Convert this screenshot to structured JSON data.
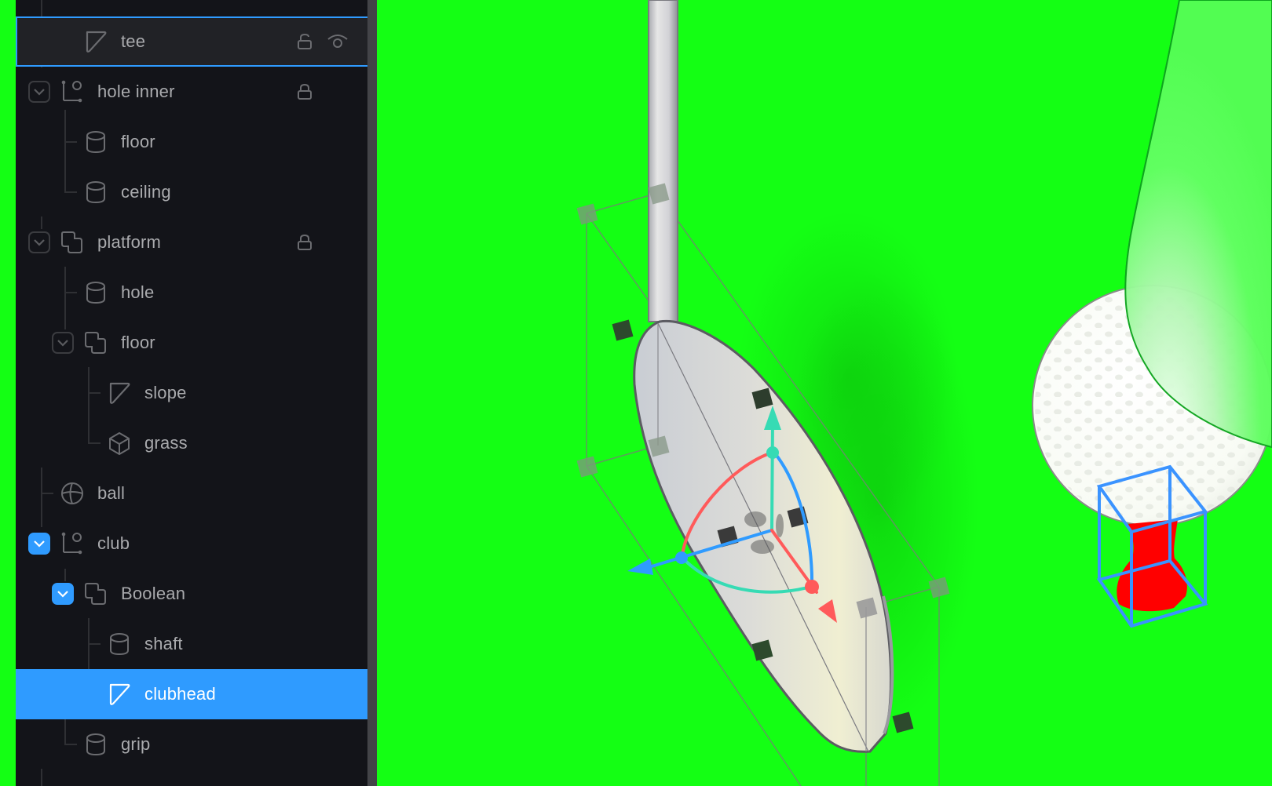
{
  "colors": {
    "viewport_background": "#14ff14",
    "panel_background": "#131419",
    "selection": "#2f9bff",
    "hover_row": "#212226",
    "text": "#a9aaad",
    "text_selected": "#ffffff",
    "gizmo_x": "#ff5a5a",
    "gizmo_y": "#36dbb4",
    "gizmo_z": "#2f9bff",
    "tee_color": "#ff0000"
  },
  "outliner": {
    "rows": [
      {
        "label": "tee",
        "icon": "plane-icon",
        "depth": 1,
        "state": "hover",
        "expander": null,
        "lock": "unlocked",
        "visibility": "visible"
      },
      {
        "label": "hole inner",
        "icon": "group-icon",
        "depth": 0,
        "state": "normal",
        "expander": "collapsed-outline",
        "lock": "locked",
        "visibility": null
      },
      {
        "label": "floor",
        "icon": "cylinder-icon",
        "depth": 1,
        "state": "normal",
        "expander": null,
        "lock": null,
        "visibility": null
      },
      {
        "label": "ceiling",
        "icon": "cylinder-icon",
        "depth": 1,
        "state": "normal",
        "expander": null,
        "lock": null,
        "visibility": null
      },
      {
        "label": "platform",
        "icon": "boolean-icon",
        "depth": 0,
        "state": "normal",
        "expander": "expanded-outline",
        "lock": "locked",
        "visibility": null
      },
      {
        "label": "hole",
        "icon": "cylinder-icon",
        "depth": 1,
        "state": "normal",
        "expander": null,
        "lock": null,
        "visibility": null
      },
      {
        "label": "floor",
        "icon": "boolean-icon",
        "depth": 1,
        "state": "normal",
        "expander": "expanded-outline",
        "lock": null,
        "visibility": null
      },
      {
        "label": "slope",
        "icon": "plane-icon",
        "depth": 2,
        "state": "normal",
        "expander": null,
        "lock": null,
        "visibility": null
      },
      {
        "label": "grass",
        "icon": "cube-icon",
        "depth": 2,
        "state": "normal",
        "expander": null,
        "lock": null,
        "visibility": null
      },
      {
        "label": "ball",
        "icon": "sphere-icon",
        "depth": 0,
        "state": "normal",
        "expander": null,
        "lock": null,
        "visibility": null
      },
      {
        "label": "club",
        "icon": "group-icon",
        "depth": 0,
        "state": "normal",
        "expander": "expanded-active",
        "lock": null,
        "visibility": null
      },
      {
        "label": "Boolean",
        "icon": "boolean-icon",
        "depth": 1,
        "state": "normal",
        "expander": "expanded-active",
        "lock": null,
        "visibility": null
      },
      {
        "label": "shaft",
        "icon": "cylinder-icon",
        "depth": 2,
        "state": "normal",
        "expander": null,
        "lock": null,
        "visibility": null
      },
      {
        "label": "clubhead",
        "icon": "plane-icon",
        "depth": 2,
        "state": "selected",
        "expander": null,
        "lock": null,
        "visibility": null
      },
      {
        "label": "grip",
        "icon": "cylinder-icon",
        "depth": 1,
        "state": "normal",
        "expander": null,
        "lock": null,
        "visibility": null
      }
    ]
  },
  "viewport": {
    "objects": [
      "shaft",
      "clubhead",
      "ball",
      "tee",
      "grass-slope"
    ],
    "selected_object": "clubhead",
    "gizmo": "transform-gizmo"
  }
}
